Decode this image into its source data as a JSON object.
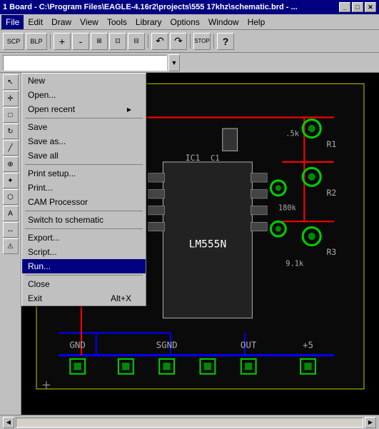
{
  "titleBar": {
    "title": "1 Board - C:\\Program Files\\EAGLE-4.16r2\\projects\\555 17khz\\schematic.brd - ...",
    "minBtn": "_",
    "maxBtn": "□",
    "closeBtn": "✕"
  },
  "menuBar": {
    "items": [
      {
        "label": "File",
        "active": true
      },
      {
        "label": "Edit"
      },
      {
        "label": "Draw"
      },
      {
        "label": "View"
      },
      {
        "label": "Tools"
      },
      {
        "label": "Library"
      },
      {
        "label": "Options"
      },
      {
        "label": "Window"
      },
      {
        "label": "Help"
      }
    ]
  },
  "toolbar": {
    "buttons": [
      "SCP",
      "BLP"
    ],
    "zoomIcons": [
      "🔍+",
      "🔍-",
      "⊞",
      "🔍□",
      "⊡"
    ],
    "undoIcon": "↶",
    "redoIcon": "↷",
    "stopIcon": "STOP",
    "helpIcon": "?"
  },
  "dropdownMenu": {
    "items": [
      {
        "label": "New",
        "shortcut": "",
        "separator": false,
        "highlighted": false
      },
      {
        "label": "Open...",
        "shortcut": "",
        "separator": false,
        "highlighted": false
      },
      {
        "label": "Open recent",
        "shortcut": "",
        "separator": false,
        "highlighted": false,
        "hasArrow": true
      },
      {
        "label": "Save",
        "shortcut": "",
        "separator": true,
        "highlighted": false
      },
      {
        "label": "Save as...",
        "shortcut": "",
        "separator": false,
        "highlighted": false
      },
      {
        "label": "Save all",
        "shortcut": "",
        "separator": true,
        "highlighted": false
      },
      {
        "label": "Print setup...",
        "shortcut": "",
        "separator": false,
        "highlighted": false
      },
      {
        "label": "Print...",
        "shortcut": "",
        "separator": false,
        "highlighted": false
      },
      {
        "label": "CAM Processor",
        "shortcut": "",
        "separator": true,
        "highlighted": false
      },
      {
        "label": "Switch to schematic",
        "shortcut": "",
        "separator": true,
        "highlighted": false
      },
      {
        "label": "Export...",
        "shortcut": "",
        "separator": false,
        "highlighted": false
      },
      {
        "label": "Script...",
        "shortcut": "",
        "separator": false,
        "highlighted": false
      },
      {
        "label": "Run...",
        "shortcut": "",
        "separator": true,
        "highlighted": true
      },
      {
        "label": "Close",
        "shortcut": "",
        "separator": false,
        "highlighted": false
      },
      {
        "label": "Exit",
        "shortcut": "Alt+X",
        "separator": false,
        "highlighted": false
      }
    ]
  },
  "statusBar": {
    "text": ""
  },
  "leftToolbar": {
    "buttons": [
      "↖",
      "↗",
      "□",
      "✎",
      "+",
      "⊕",
      "✦",
      "⊞",
      "⊡",
      "⊛",
      "⚠"
    ]
  }
}
